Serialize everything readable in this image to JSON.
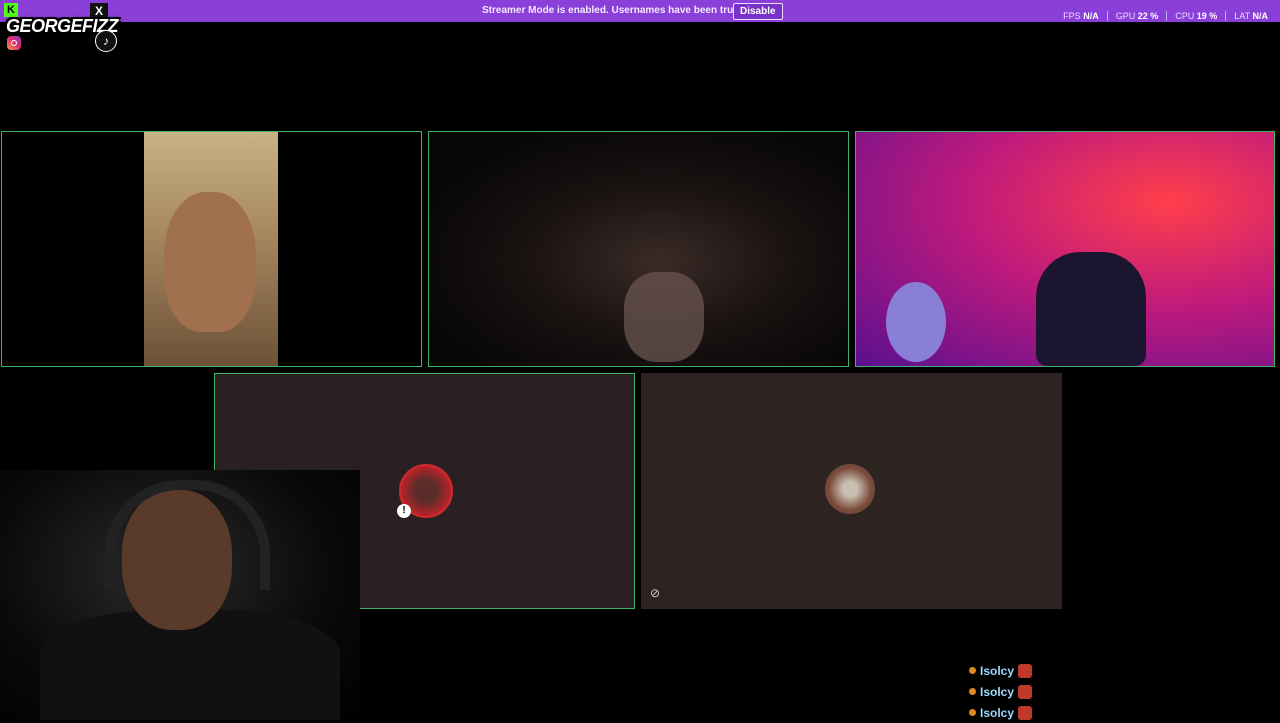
{
  "banner": {
    "message": "Streamer Mode is enabled. Usernames have been truncated.",
    "disable_label": "Disable",
    "color": "#8b3fd9"
  },
  "stats": [
    {
      "label": "FPS",
      "value": "N/A"
    },
    {
      "label": "GPU",
      "value": "22 %"
    },
    {
      "label": "CPU",
      "value": "19 %"
    },
    {
      "label": "LAT",
      "value": "N/A"
    }
  ],
  "overlay": {
    "brand": "GEORGEFIZZ",
    "kick_icon": "K",
    "x_icon": "X",
    "tiktok_icon": "♪"
  },
  "tiles": {
    "border_color": "#3bb56a",
    "mute_icon": "!",
    "deafen_icon": "⊘"
  },
  "chat": {
    "rows": [
      {
        "name": "Isolcy"
      },
      {
        "name": "Isolcy"
      },
      {
        "name": "Isolcy"
      }
    ]
  }
}
